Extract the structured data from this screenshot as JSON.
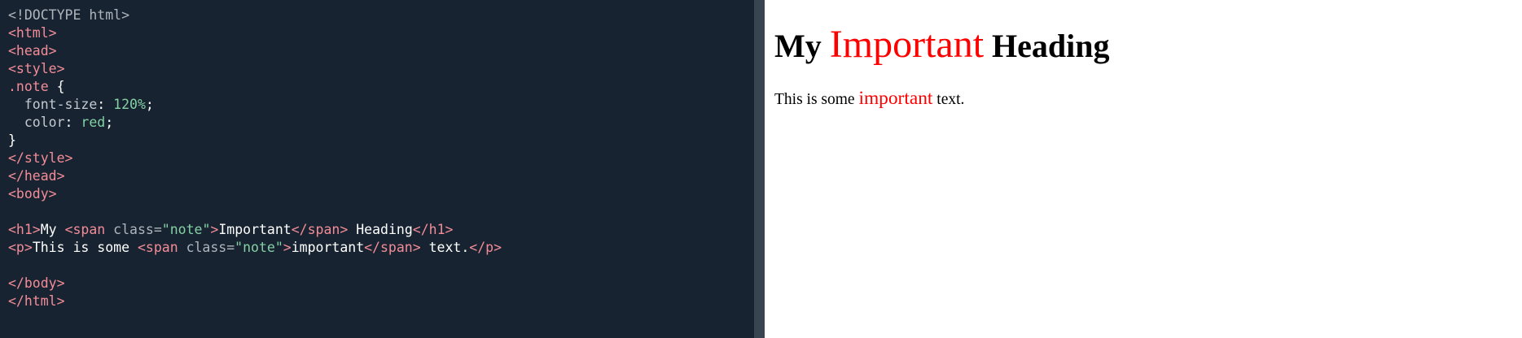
{
  "editor": {
    "lines": [
      [
        {
          "t": "doctype",
          "s": "<!DOCTYPE html>"
        }
      ],
      [
        {
          "t": "tag",
          "s": "<html>"
        }
      ],
      [
        {
          "t": "tag",
          "s": "<head>"
        }
      ],
      [
        {
          "t": "tag",
          "s": "<style>"
        }
      ],
      [
        {
          "t": "tag",
          "s": ".note"
        },
        {
          "t": "text",
          "s": " {"
        }
      ],
      [
        {
          "t": "prop",
          "s": "  font-size"
        },
        {
          "t": "text",
          "s": ": "
        },
        {
          "t": "val",
          "s": "120%"
        },
        {
          "t": "text",
          "s": ";"
        }
      ],
      [
        {
          "t": "prop",
          "s": "  color"
        },
        {
          "t": "text",
          "s": ": "
        },
        {
          "t": "val",
          "s": "red"
        },
        {
          "t": "text",
          "s": ";"
        }
      ],
      [
        {
          "t": "text",
          "s": "}"
        }
      ],
      [
        {
          "t": "tag",
          "s": "</style>"
        }
      ],
      [
        {
          "t": "tag",
          "s": "</head>"
        }
      ],
      [
        {
          "t": "tag",
          "s": "<body>"
        }
      ],
      [],
      [
        {
          "t": "tag",
          "s": "<h1>"
        },
        {
          "t": "text",
          "s": "My "
        },
        {
          "t": "tag",
          "s": "<span "
        },
        {
          "t": "attr",
          "s": "class="
        },
        {
          "t": "val",
          "s": "\"note\""
        },
        {
          "t": "tag",
          "s": ">"
        },
        {
          "t": "text",
          "s": "Important"
        },
        {
          "t": "tag",
          "s": "</span>"
        },
        {
          "t": "text",
          "s": " Heading"
        },
        {
          "t": "tag",
          "s": "</h1>"
        }
      ],
      [
        {
          "t": "tag",
          "s": "<p>"
        },
        {
          "t": "text",
          "s": "This is some "
        },
        {
          "t": "tag",
          "s": "<span "
        },
        {
          "t": "attr",
          "s": "class="
        },
        {
          "t": "val",
          "s": "\"note\""
        },
        {
          "t": "tag",
          "s": ">"
        },
        {
          "t": "text",
          "s": "important"
        },
        {
          "t": "tag",
          "s": "</span>"
        },
        {
          "t": "text",
          "s": " text."
        },
        {
          "t": "tag",
          "s": "</p>"
        }
      ],
      [],
      [
        {
          "t": "tag",
          "s": "</body>"
        }
      ],
      [
        {
          "t": "tag",
          "s": "</html>"
        }
      ]
    ],
    "colors": {
      "background": "#172330",
      "tag": "#f38c98",
      "value": "#85d1a5",
      "text": "#ffffff"
    }
  },
  "preview": {
    "heading": {
      "before": "My ",
      "note": "Important",
      "after": " Heading"
    },
    "paragraph": {
      "before": "This is some ",
      "note": "important",
      "after": " text."
    },
    "note_color": "#ff0000"
  }
}
